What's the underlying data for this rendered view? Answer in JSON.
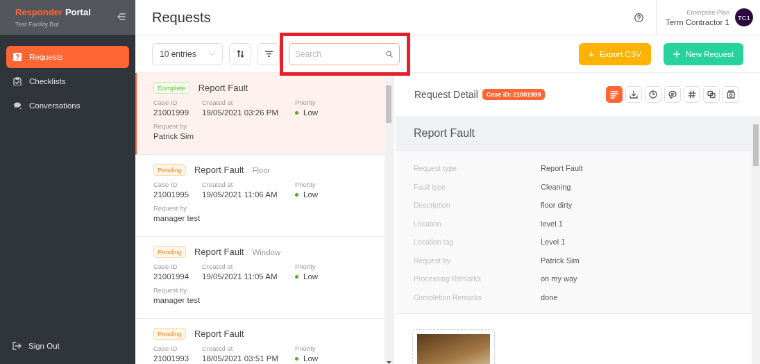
{
  "sidebar": {
    "brand_accent": "Responder",
    "brand": "Portal",
    "subtitle": "Test Facility Bot",
    "items": [
      {
        "label": "Requests",
        "kind": "question",
        "selected": true
      },
      {
        "label": "Checklists",
        "kind": "clipboard",
        "selected": false
      },
      {
        "label": "Conversations",
        "kind": "chat",
        "selected": false
      }
    ],
    "footer": {
      "label": "Sign Out"
    }
  },
  "header": {
    "title": "Requests",
    "plan": "Enterprise Plan",
    "user": "Term Contractor 1",
    "avatar": "TC1"
  },
  "toolbar": {
    "entries": "10 entries",
    "search": {
      "placeholder": "Search",
      "highlighted": true
    },
    "buttons": [
      {
        "label": "Export CSV",
        "kind": "export"
      },
      {
        "label": "New Request",
        "kind": "new"
      }
    ]
  },
  "requests": [
    {
      "status": "Complete",
      "title": "Report Fault",
      "selected": true,
      "case_id_label": "Case ID",
      "case_id": "21001999",
      "created_label": "Created at",
      "created": "19/05/2021 03:26 PM",
      "priority_label": "Priority",
      "priority": "Low",
      "requester_label": "Request by",
      "requester": "Patrick Sim"
    },
    {
      "status": "Pending",
      "title": "Report Fault",
      "tag": "Floor",
      "selected": false,
      "case_id_label": "Case ID",
      "case_id": "21001995",
      "created_label": "Created at",
      "created": "19/05/2021 11:06 AM",
      "priority_label": "Priority",
      "priority": "Low",
      "requester_label": "Request by",
      "requester": "manager test"
    },
    {
      "status": "Pending",
      "title": "Report Fault",
      "tag": "Window",
      "selected": false,
      "case_id_label": "Case ID",
      "case_id": "21001994",
      "created_label": "Created at",
      "created": "19/05/2021 11:05 AM",
      "priority_label": "Priority",
      "priority": "Low",
      "requester_label": "Request by",
      "requester": "manager test"
    },
    {
      "status": "Pending",
      "title": "Report Fault",
      "selected": false,
      "case_id_label": "Case ID",
      "case_id": "21001993",
      "created_label": "Created at",
      "created": "18/05/2021 03:51 PM",
      "priority_label": "Priority",
      "priority": "Low"
    }
  ],
  "detail": {
    "title": "Request Detail",
    "case_badge": "Case ID: 21001999",
    "tools": [
      {
        "kind": "lines",
        "selected": true
      },
      {
        "kind": "download",
        "selected": false
      },
      {
        "kind": "clock",
        "selected": false
      },
      {
        "kind": "chat",
        "selected": false
      },
      {
        "kind": "hash",
        "selected": false
      },
      {
        "kind": "copy",
        "selected": false
      },
      {
        "kind": "photo",
        "selected": false
      }
    ],
    "heading": "Report Fault",
    "fields": [
      {
        "label": "Request type",
        "value": "Report Fault"
      },
      {
        "label": "Fault type",
        "value": "Cleaning"
      },
      {
        "label": "Description",
        "value": "floor dirty"
      },
      {
        "label": "Location",
        "value": "level 1"
      },
      {
        "label": "Location tag",
        "value": "Level 1"
      },
      {
        "label": "Request by",
        "value": "Patrick Sim"
      },
      {
        "label": "Processing Remarks",
        "value": "on my way"
      },
      {
        "label": "Completion Remarks",
        "value": "done"
      }
    ]
  }
}
